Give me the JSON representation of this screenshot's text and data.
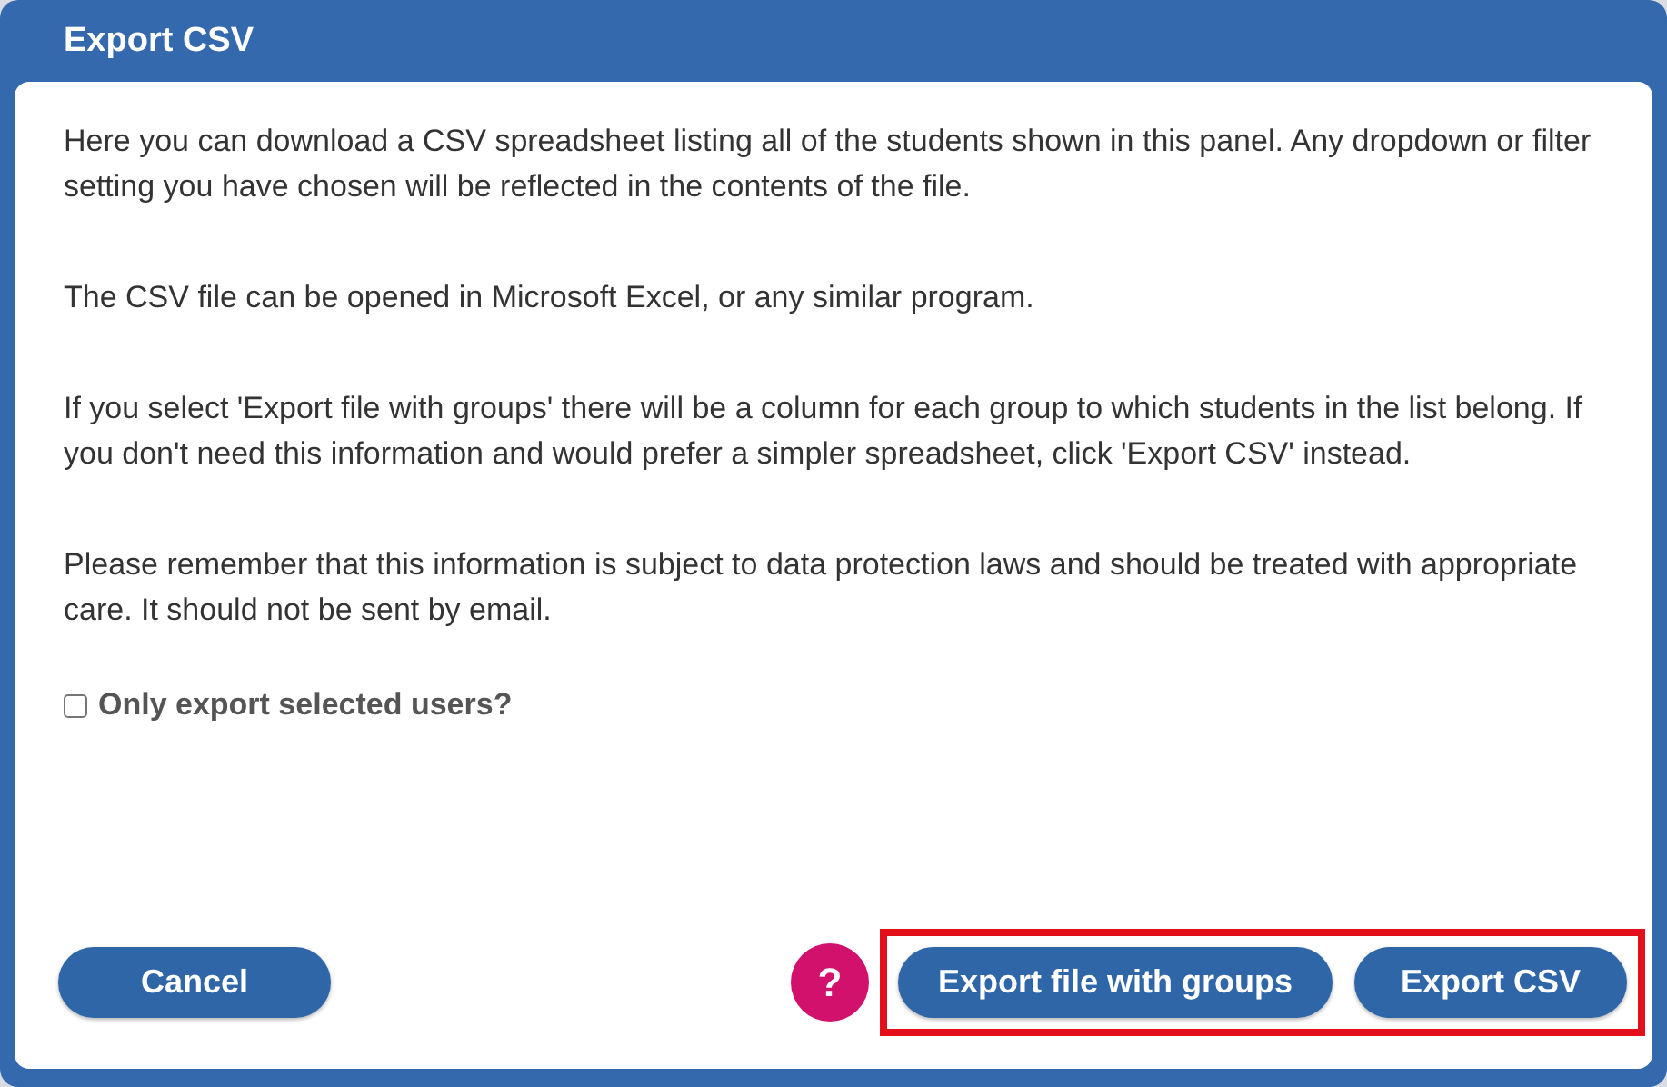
{
  "dialog": {
    "title": "Export CSV",
    "paragraphs": [
      "Here you can download a CSV spreadsheet listing all of the students shown in this panel. Any dropdown or filter setting you have chosen will be reflected in the contents of the file.",
      "The CSV file can be opened in Microsoft Excel, or any similar program.",
      "If you select 'Export file with groups' there will be a column for each group to which students in the list belong. If you don't need this information and would prefer a simpler spreadsheet, click 'Export CSV' instead.",
      "Please remember that this information is subject to data protection laws and should be treated with appropriate care. It should not be sent by email."
    ],
    "checkbox": {
      "label": "Only export selected users?",
      "checked": false
    },
    "cancel": "Cancel",
    "help": "?",
    "actions": {
      "highlighted": true,
      "buttons": [
        "Export file with groups",
        "Export CSV"
      ]
    }
  }
}
